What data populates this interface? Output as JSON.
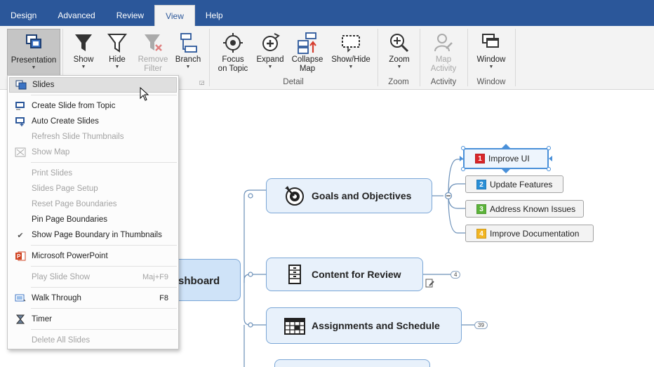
{
  "tabs": [
    {
      "label": "Design",
      "active": false
    },
    {
      "label": "Advanced",
      "active": false
    },
    {
      "label": "Review",
      "active": false
    },
    {
      "label": "View",
      "active": true
    },
    {
      "label": "Help",
      "active": false
    }
  ],
  "ribbon": {
    "presentation": {
      "label": "Presentation"
    },
    "show": {
      "label": "Show"
    },
    "hide": {
      "label": "Hide"
    },
    "remove_filter": {
      "line1": "Remove",
      "line2": "Filter"
    },
    "branch": {
      "label": "Branch"
    },
    "focus_on_topic": {
      "line1": "Focus",
      "line2": "on Topic"
    },
    "expand": {
      "label": "Expand"
    },
    "collapse_map": {
      "line1": "Collapse",
      "line2": "Map"
    },
    "show_hide": {
      "label": "Show/Hide"
    },
    "zoom": {
      "label": "Zoom"
    },
    "map_activity": {
      "line1": "Map",
      "line2": "Activity"
    },
    "window": {
      "label": "Window"
    },
    "groups": {
      "detail": "Detail",
      "zoom": "Zoom",
      "activity": "Activity",
      "window": "Window"
    }
  },
  "menu": {
    "items": {
      "slides": {
        "label": "Slides"
      },
      "create_slide": {
        "label": "Create Slide from Topic"
      },
      "auto_create": {
        "label": "Auto Create Slides"
      },
      "refresh_thumbs": {
        "label": "Refresh Slide Thumbnails"
      },
      "show_map": {
        "label": "Show Map"
      },
      "print_slides": {
        "label": "Print Slides"
      },
      "page_setup": {
        "label": "Slides Page Setup"
      },
      "reset_boundaries": {
        "label": "Reset Page Boundaries"
      },
      "pin_boundaries": {
        "label": "Pin Page Boundaries"
      },
      "show_boundary": {
        "label": "Show Page Boundary in Thumbnails",
        "checked": true
      },
      "powerpoint": {
        "label": "Microsoft PowerPoint"
      },
      "play": {
        "label": "Play Slide Show",
        "shortcut": "Maj+F9"
      },
      "walk": {
        "label": "Walk Through",
        "shortcut": "F8"
      },
      "timer": {
        "label": "Timer"
      },
      "delete_all": {
        "label": "Delete All Slides"
      }
    }
  },
  "map": {
    "central_text": "shboard",
    "topics": {
      "goals": "Goals and Objectives",
      "content": "Content for Review",
      "assignments": "Assignments and Schedule"
    },
    "subtopics": [
      {
        "priority": "1",
        "label": "Improve UI",
        "color": "#d9262a"
      },
      {
        "priority": "2",
        "label": "Update Features",
        "color": "#2a8fd6"
      },
      {
        "priority": "3",
        "label": "Address Known Issues",
        "color": "#5cb33a"
      },
      {
        "priority": "4",
        "label": "Improve Documentation",
        "color": "#f2b522"
      }
    ],
    "badges": {
      "content": "4",
      "assignments": "39"
    }
  },
  "colors": {
    "tabbar": "#2b579a",
    "ribbon": "#f3f3f3",
    "topic_fill": "#e8f1fb",
    "topic_border": "#7aa6d6",
    "selection": "#4a90d9"
  }
}
